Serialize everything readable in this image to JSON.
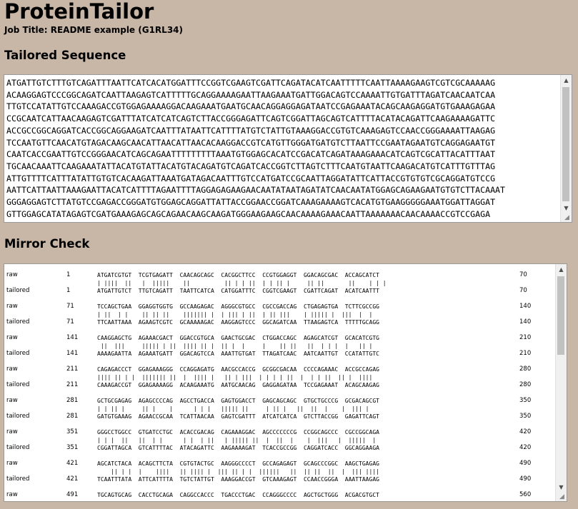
{
  "app": {
    "title": "ProteinTailor",
    "job_title": "Job Title: README example (G1RL34)"
  },
  "tailored": {
    "heading": "Tailored Sequence",
    "lines": [
      "ATGATTGTCTTTGTCAGATTTAATTCATCACATGGATTTCCGGTCGAAGTCGATTCAGATACATCAATTTTTCAATTAAAAGAAGTCGTCGCAAAAAG",
      "ACAAGGAGTCCCGGCAGATCAATTAAGAGTCATTTTTGCAGGAAAAGAATTAAGAAATGATTGGACAGTCCAAAATTGTGATTTAGATCAACAATCAA",
      "TTGTCCATATTGTCCAAAGACCGTGGAGAAAAGGACAAGAAATGAATGCAACAGGAGGAGATAATCCGAGAAATACAGCAAGAGGATGTGAAAGAGAA",
      "CCGCAATCATTAACAAGAGTCGATTTATCATCATCAGTCTTACCGGGAGATTCAGTCGGATTAGCAGTCATTTTACATACAGATTCAAGAAAAGATTC",
      "ACCGCCGGCAGGATCACCGGCAGGAAGATCAATTTATAATTCATTTTATGTCTATTGTAAAGGACCGTGTCAAAGAGTCCAACCGGGAAAATTAAGAG",
      "TCCAATGTTCAACATGTAGACAAGCAACATTAACATTAACACAAGGACCGTCATGTTGGGATGATGTCTTAATTCCGAATAGAATGTCAGGAGAATGT",
      "CAATCACCGAATTGTCCGGGAACATCAGCAGAATTTTTTTTTAAATGTGGAGCACATCCGACATCAGATAAAGAAACATCAGTCGCATTACATTTAAT",
      "TGCAACAAATTCAAGAAATATTACATGTATTACATGTACAGATGTCAGATCACCGGTCTTAGTCTTTCAATGTAATTCAAGACATGTCATTTGTTTAG",
      "ATTGTTTTCATTTATATTGTGTCACAAGATTAAATGATAGACAATTTGTCCATGATCCGCAATTAGGATATTCATTACCGTGTGTCGCAGGATGTCCG",
      "AATTCATTAATTAAAGAATTACATCATTTTAGAATTTTAGGAGAGAAGAACAATATAATAGATATCAACAATATGGAGCAGAAGAATGTGTCTTACAAAT",
      "GGGAGGAGTCTTATGTCCGAGACCGGGATGTGGAGCAGGATTATTACCGGAACCGGATCAAAGAAAAGTCACATGTGAAGGGGGAAATGGATTAGGAT",
      "GTTGGAGCATATAGAGTCGATGAAAGAGCAGCAGAACAAGCAAGATGGGAAGAAGCAACAAAAGAAACAATTAAAAAAACAACAAAACCGTCCGAGA"
    ]
  },
  "mirror": {
    "heading": "Mirror Check",
    "raw_label": "raw",
    "tailored_label": "tailored",
    "blocks": [
      {
        "start": "1",
        "end": "70",
        "raw": "ATGATCGTGT  TCGTGAGATT  CAACAGCAGC  CACGGCTTCC  CCGTGGAGGT  GGACAGCGAC  ACCAGCATCT",
        "match": "| ||||  ||   |  |||||    ||          || | | ||  | | || |     || ||       ||    | | |",
        "tailored": "ATGATTGTCT  TTGTCAGATT  TAATTCATCA  CATGGATTTC  CGGTCGAAGT  CGATTCAGAT  ACATCAATTT"
      },
      {
        "start": "71",
        "end": "140",
        "raw": "TCCAGCTGAA  GGAGGTGGTG  GCCAAGAGAC  AGGGCGTGCC  CGCCGACCAG  CTGAGAGTGA  TCTTCGCCGG",
        "match": "| ||  | |    || || ||    ||||||| |  | ||| | ||  | || |||    | ||||| |  |||  |  |",
        "tailored": "TTCAATTAAA  AGAAGTCGTC  GCAAAAAGAC  AAGGAGTCCC  GGCAGATCAA  TTAAGAGTCA  TTTTTGCAGG"
      },
      {
        "start": "141",
        "end": "210",
        "raw": "CAAGGAGCTG  AGAAACGACT  GGACCGTGCA  GAACTGCGAC  CTGGACCAGC  AGAGCATCGT  GCACATCGTG",
        "match": " ||  |||     ||||| | ||  |||| || |  || |  |     |    || ||   ||  | | |  |   || |",
        "tailored": "AAAAGAATTA  AGAAATGATT  GGACAGTCCA  AAATTGTGAT  TTAGATCAAC  AATCAATTGT  CCATATTGTC"
      },
      {
        "start": "211",
        "end": "280",
        "raw": "CAGAGACCCT  GGAGAAAGGG  CCAGGAGATG  AACGCCACCG  GCGGCGACAA  CCCCAGAAAC  ACCGCCAGAG",
        "match": "|||| || | |  ||||||| ||  |  |||| |   || | |||  | | | | ||  |  | | ||  || |  ||||",
        "tailored": "CAAAGACCGT  GGAGAAAAGG  ACAAGAAATG  AATGCAACAG  GAGGAGATAA  TCCGAGAAAT  ACAGCAAGAG"
      },
      {
        "start": "281",
        "end": "350",
        "raw": "GCTGCGAGAG  AGAGCCCCAG  AGCCTGACCA  GAGTGGACCT  GAGCAGCAGC  GTGCTGCCCG  GCGACAGCGT",
        "match": "| | || |     || |    |      | | |   ||||| ||     | || |   ||  ||  |    |  ||| |",
        "tailored": "GATGTGAAAG  AGAACCGCAA  TCATTAACAA  GAGTCGATTT  ATCATCATCA  GTCTTACCGG  GAGATTCAGT"
      },
      {
        "start": "351",
        "end": "420",
        "raw": "GGGCCTGGCC  GTGATCCTGC  ACACCGACAG  CAGAAAGGAC  AGCCCCCCCG  CCGGCAGCCC  CGCCGGCAGA",
        "match": "| | |  ||   ||  | |      | |  | ||   | ||||| ||  |  ||  |    |  |||   |  |||||  |",
        "tailored": "CGGATTAGCA  GTCATTTTAC  ATACAGATTC  AAGAAAAGAT  TCACCGCCGG  CAGGATCACC  GGCAGGAAGA"
      },
      {
        "start": "421",
        "end": "490",
        "raw": "AGCATCTACA  ACAGCTTCTA  CGTGTACTGC  AAGGGCCCCT  GCCAGAGAGT  GCAGCCCGGC  AAGCTGAGAG",
        "match": "    || | |  |    ||||   || |||| |  ||| || | |  ||||||   ||  || ||  ||  |  ||| ||||",
        "tailored": "TCAATTTATA  ATTCATTTTA  TGTCTATTGT  AAAGGACCGT  GTCAAAGAGT  CCAACCGGGA  AAATTAAGAG"
      },
      {
        "start": "491",
        "end": "560",
        "raw": "TGCAGTGCAG  CACCTGCAGA  CAGGCCACCC  TGACCCTGAC  CCAGGGCCCC  AGCTGCTGGG  ACGACGTGCT",
        "match": "",
        "tailored": ""
      }
    ]
  }
}
